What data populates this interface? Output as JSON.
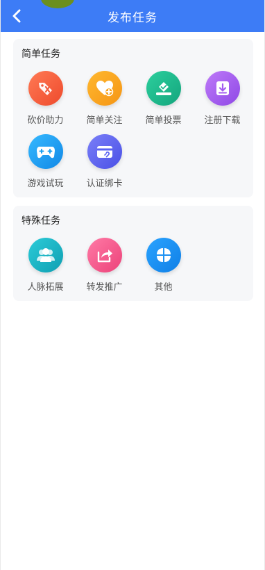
{
  "header": {
    "title": "发布任务",
    "back_icon": "chevron-left-icon",
    "background": "#3d7cf6"
  },
  "sections": [
    {
      "title": "简单任务",
      "items": [
        {
          "label": "砍价助力",
          "icon": "price-tag-cut-icon",
          "color": "#f25a3c"
        },
        {
          "label": "简单关注",
          "icon": "heart-plus-icon",
          "color": "#f9a21a"
        },
        {
          "label": "简单投票",
          "icon": "vote-check-icon",
          "color": "#1cb68a"
        },
        {
          "label": "注册下载",
          "icon": "download-icon",
          "color": "#a35bf0"
        },
        {
          "label": "游戏试玩",
          "icon": "gamepad-icon",
          "color": "#1a9ff0"
        },
        {
          "label": "认证绑卡",
          "icon": "card-link-icon",
          "color": "#5a62f2"
        }
      ]
    },
    {
      "title": "特殊任务",
      "items": [
        {
          "label": "人脉拓展",
          "icon": "people-icon",
          "color": "#17b2c4"
        },
        {
          "label": "转发推广",
          "icon": "share-icon",
          "color": "#f35a8e"
        },
        {
          "label": "其他",
          "icon": "four-petal-icon",
          "color": "#1a8ff0"
        }
      ]
    }
  ]
}
